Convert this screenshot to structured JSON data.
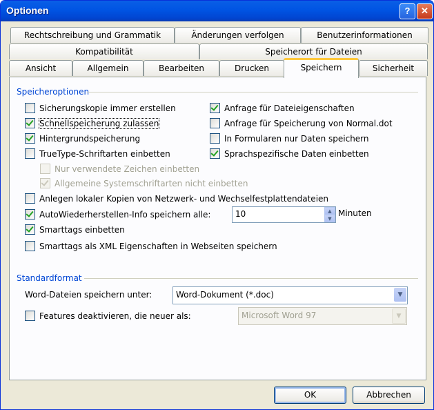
{
  "window": {
    "title": "Optionen"
  },
  "tabs": {
    "row1": [
      "Rechtschreibung und Grammatik",
      "Änderungen verfolgen",
      "Benutzerinformationen"
    ],
    "row2": [
      "Kompatibilität",
      "Speicherort für Dateien"
    ],
    "row3": [
      "Ansicht",
      "Allgemein",
      "Bearbeiten",
      "Drucken",
      "Speichern",
      "Sicherheit"
    ],
    "active": "Speichern"
  },
  "speicheroptionen": {
    "title": "Speicheroptionen",
    "left": [
      {
        "label": "Sicherungskopie immer erstellen",
        "checked": false
      },
      {
        "label": "Schnellspeicherung zulassen",
        "checked": true
      },
      {
        "label": "Hintergrundspeicherung",
        "checked": true
      },
      {
        "label": "TrueType-Schriftarten einbetten",
        "checked": false
      }
    ],
    "sub": [
      {
        "label": "Nur verwendete Zeichen einbetten",
        "checked": false,
        "disabled": true
      },
      {
        "label": "Allgemeine Systemschriftarten nicht einbetten",
        "checked": true,
        "disabled": true
      }
    ],
    "right": [
      {
        "label": "Anfrage für Dateieigenschaften",
        "checked": true
      },
      {
        "label": "Anfrage für Speicherung von Normal.dot",
        "checked": false
      },
      {
        "label": "In Formularen nur Daten speichern",
        "checked": false
      },
      {
        "label": "Sprachspezifische Daten einbetten",
        "checked": true
      }
    ],
    "bottom": [
      {
        "label": "Anlegen lokaler Kopien von Netzwerk- und Wechselfestplattendateien",
        "checked": false
      },
      {
        "label": "AutoWiederherstellen-Info speichern alle:",
        "checked": true
      },
      {
        "label": "Smarttags einbetten",
        "checked": true
      },
      {
        "label": "Smarttags als XML Eigenschaften in Webseiten speichern",
        "checked": false
      }
    ],
    "autosave_value": "10",
    "autosave_unit": "Minuten"
  },
  "standardformat": {
    "title": "Standardformat",
    "save_as_label": "Word-Dateien speichern unter:",
    "save_as_value": "Word-Dokument (*.doc)",
    "disable_features_label": "Features deaktivieren, die neuer als:",
    "disable_features_checked": false,
    "disable_features_value": "Microsoft Word 97"
  },
  "buttons": {
    "ok": "OK",
    "cancel": "Abbrechen"
  }
}
